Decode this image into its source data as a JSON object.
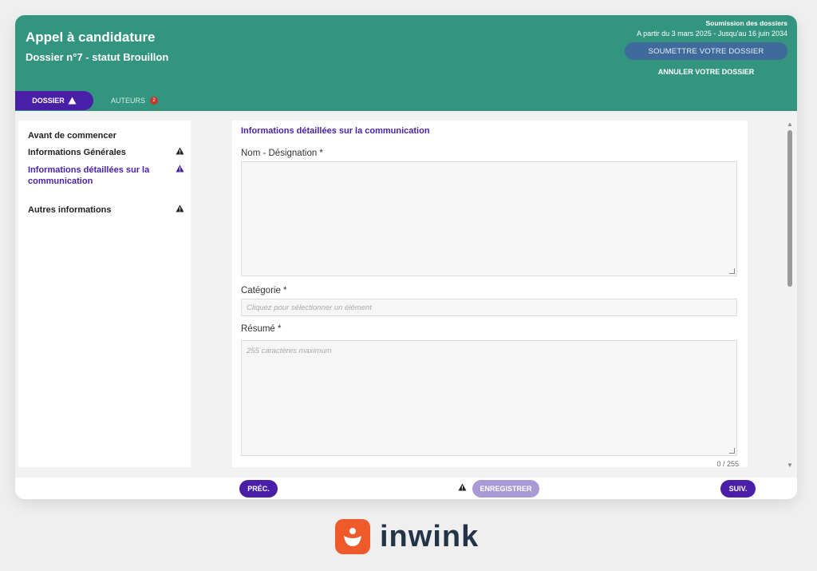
{
  "header": {
    "title": "Appel à candidature",
    "dossier": "Dossier n°7 - statut Brouillon",
    "submission_title": "Soumission des dossiers",
    "submission_dates": "A partir du 3 mars 2025 - Jusqu'au 16 juin 2034",
    "submit_label": "SOUMETTRE VOTRE DOSSIER",
    "cancel_label": "ANNULER VOTRE DOSSIER"
  },
  "tabs": [
    {
      "label": "DOSSIER",
      "active": true
    },
    {
      "label": "AUTEURS",
      "badge": "2"
    }
  ],
  "sidebar": {
    "items": [
      {
        "label": "Avant de commencer",
        "warning": false
      },
      {
        "label": "Informations Générales",
        "warning": true
      },
      {
        "label": "Informations détaillées sur la communication",
        "warning": true,
        "active": true
      },
      {
        "label": "Autres informations",
        "warning": true
      }
    ]
  },
  "form": {
    "section_title": "Informations détaillées sur la communication",
    "name_label": "Nom - Désignation *",
    "name_value": "",
    "category_label": "Catégorie *",
    "category_placeholder": "Cliquez pour sélectionner un élément",
    "summary_label": "Résumé *",
    "summary_placeholder": "255 caractères maximum",
    "summary_counter": "0 / 255"
  },
  "footer": {
    "prev_label": "PRÉC.",
    "save_label": "ENREGISTRER",
    "next_label": "SUIV."
  },
  "brand": {
    "name": "inwink",
    "color": "#ef5a2a"
  },
  "colors": {
    "header": "#33957f",
    "accent": "#4a1fa8",
    "submit": "#3f6b9b",
    "save_disabled": "#a99ad6",
    "badge": "#c0392b"
  },
  "icons": {
    "warning": "warning-triangle-icon",
    "scroll_up": "arrow-up-icon",
    "scroll_down": "arrow-down-icon"
  }
}
